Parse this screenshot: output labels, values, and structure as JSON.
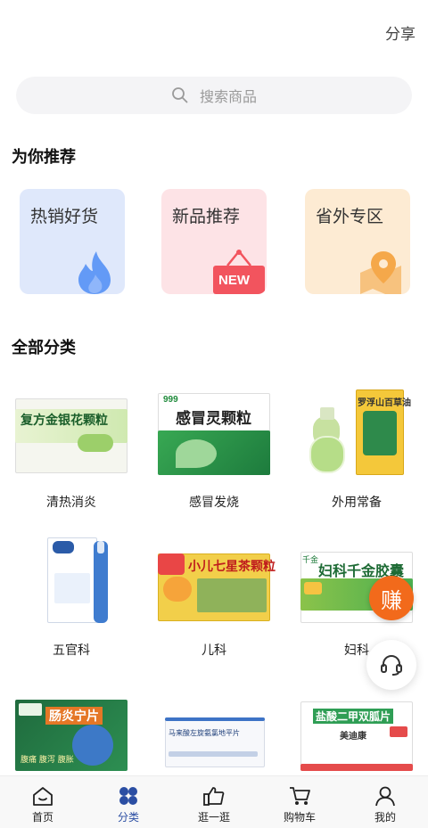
{
  "header": {
    "share_label": "分享"
  },
  "search": {
    "placeholder": "搜索商品"
  },
  "recommend": {
    "title": "为你推荐",
    "cards": [
      {
        "label": "热销好货",
        "bg": "#dfe8fb",
        "icon": "flame-icon",
        "icon_color": "#4d8cf5"
      },
      {
        "label": "新品推荐",
        "bg": "#fde3e6",
        "icon": "new-sign-icon",
        "icon_color": "#f2545e",
        "badge": "NEW"
      },
      {
        "label": "省外专区",
        "bg": "#fdebd3",
        "icon": "map-pin-icon",
        "icon_color": "#f7b65e"
      }
    ]
  },
  "categories": {
    "title": "全部分类",
    "items": [
      {
        "name": "清热消炎",
        "box_text": "复方金银花颗粒"
      },
      {
        "name": "感冒发烧",
        "box_text": "感冒灵颗粒",
        "box_brand": "999"
      },
      {
        "name": "外用常备",
        "box_text": "罗浮山百草油"
      },
      {
        "name": "五官科",
        "box_text": ""
      },
      {
        "name": "儿科",
        "box_text": "小儿七星茶颗粒"
      },
      {
        "name": "妇科",
        "box_text": "妇科千金胶囊",
        "box_brand": "千金"
      },
      {
        "name": "",
        "box_text": "肠炎宁片",
        "box_sub": "腹痛 腹泻 腹胀"
      },
      {
        "name": "",
        "box_text": "马来酸左旋氨氯地平片"
      },
      {
        "name": "",
        "box_text": "盐酸二甲双胍片",
        "box_sub": "美迪康"
      }
    ]
  },
  "floating": {
    "earn_label": "赚"
  },
  "tabbar": {
    "active_color": "#2b4ea3",
    "items": [
      {
        "label": "首页",
        "icon": "home-icon"
      },
      {
        "label": "分类",
        "icon": "category-icon",
        "active": true
      },
      {
        "label": "逛一逛",
        "icon": "thumbs-up-icon"
      },
      {
        "label": "购物车",
        "icon": "cart-icon"
      },
      {
        "label": "我的",
        "icon": "user-icon"
      }
    ]
  }
}
